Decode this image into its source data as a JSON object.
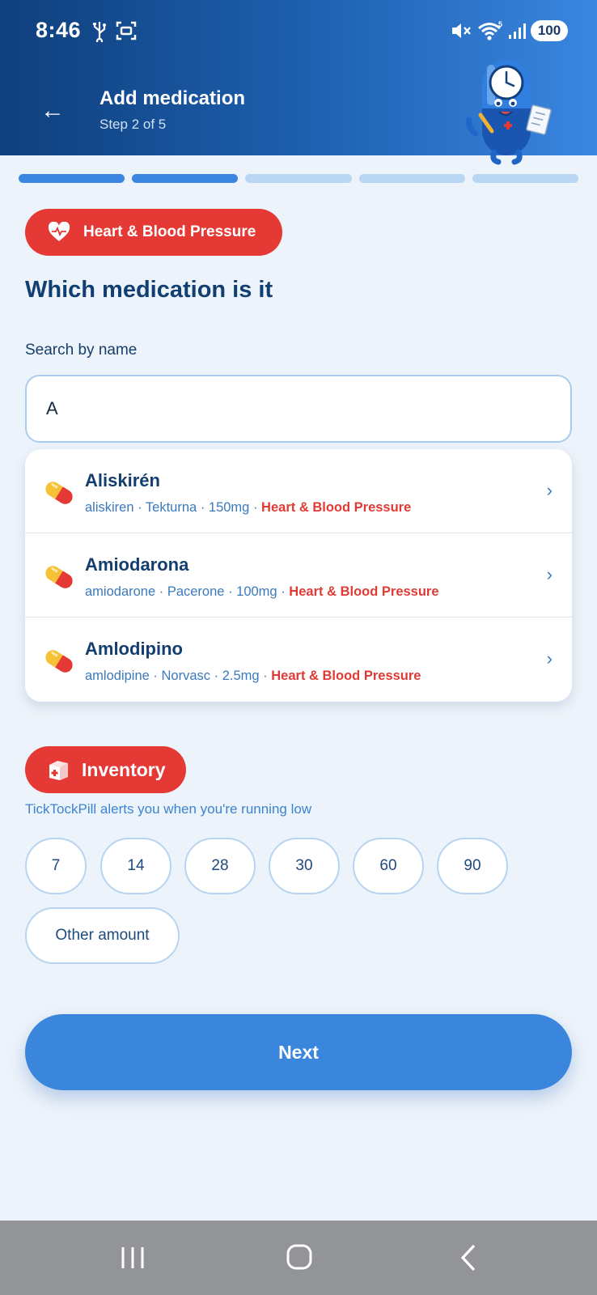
{
  "status_bar": {
    "time": "8:46",
    "battery": "100"
  },
  "header": {
    "back": "←",
    "title": "Add medication",
    "step": "Step 2 of 5"
  },
  "progress": {
    "total_steps": 5,
    "current_step": 2
  },
  "category": {
    "label": "Heart & Blood Pressure"
  },
  "question": "Which medication is it",
  "search": {
    "label": "Search by name",
    "value": "A"
  },
  "results": [
    {
      "name": "Aliskirén",
      "generic": "aliskiren",
      "brand": "Tekturna",
      "dose": "150mg",
      "category": "Heart & Blood Pressure"
    },
    {
      "name": "Amiodarona",
      "generic": "amiodarone",
      "brand": "Pacerone",
      "dose": "100mg",
      "category": "Heart & Blood Pressure"
    },
    {
      "name": "Amlodipino",
      "generic": "amlodipine",
      "brand": "Norvasc",
      "dose": "2.5mg",
      "category": "Heart & Blood Pressure"
    }
  ],
  "separator": "·",
  "chevron": "›",
  "inventory": {
    "label": "Inventory",
    "note": "TickTockPill alerts you when you're running low",
    "options": [
      "7",
      "14",
      "28",
      "30",
      "60",
      "90"
    ],
    "other": "Other amount"
  },
  "next_label": "Next",
  "colors": {
    "accent": "#3a86dd",
    "category_red": "#e53935",
    "title_blue": "#123f72"
  }
}
